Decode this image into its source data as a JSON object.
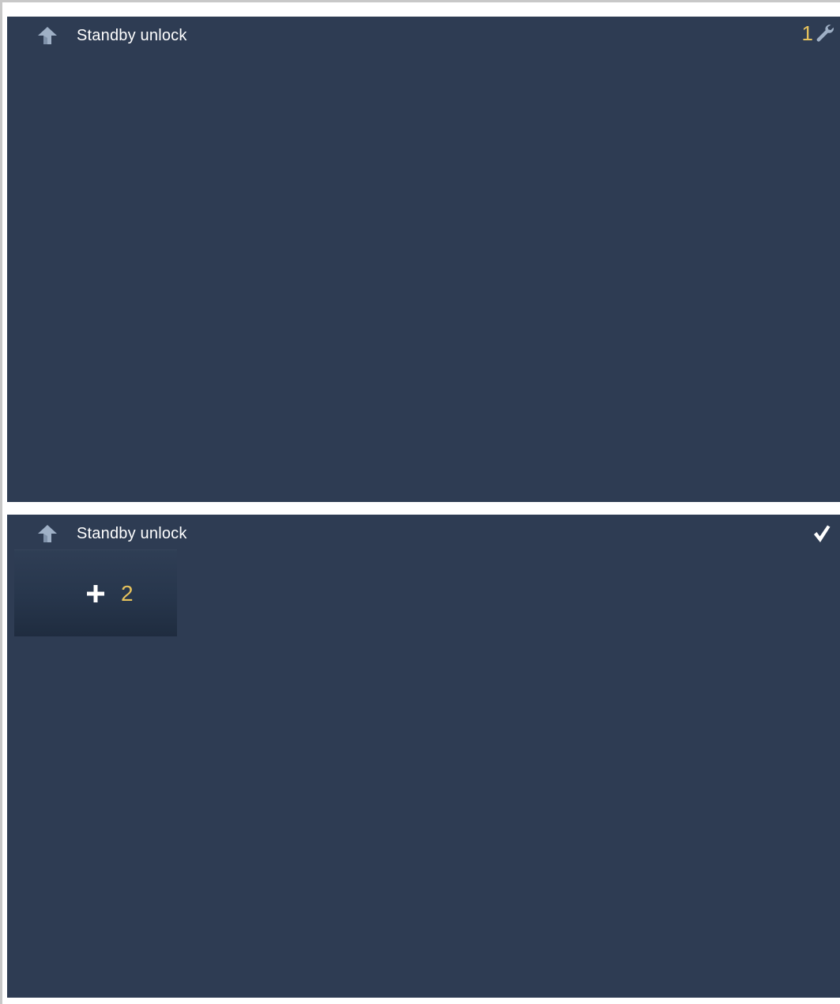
{
  "panels": [
    {
      "title": "Standby unlock",
      "callout": "1",
      "right_icon": "wrench-icon"
    },
    {
      "title": "Standby unlock",
      "right_icon": "checkmark-icon",
      "add_tile": {
        "icon": "plus-icon",
        "callout": "2"
      }
    }
  ],
  "colors": {
    "screen_background": "#2e3c53",
    "title_text": "#ffffff",
    "callout_text": "#e6c25c",
    "icon_grey": "#9fb0c6"
  }
}
